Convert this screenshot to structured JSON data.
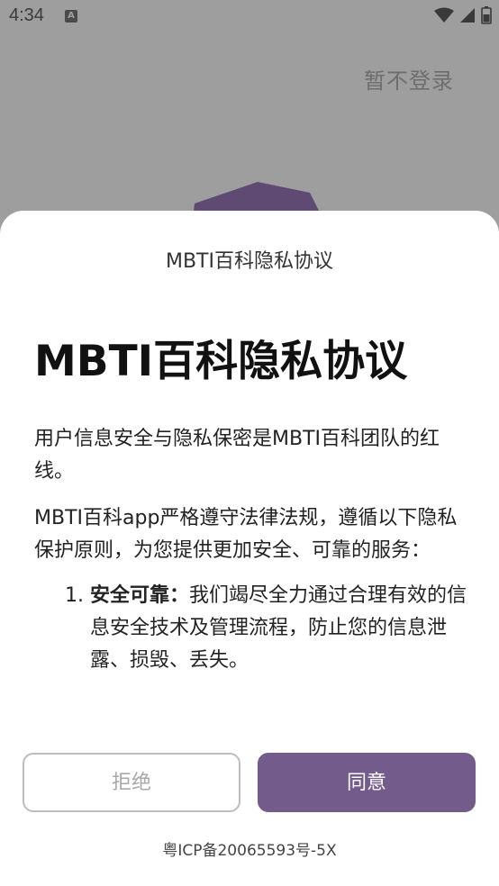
{
  "status_bar": {
    "time": "4:34",
    "notification_icon": "A"
  },
  "background": {
    "skip_login": "暂不登录"
  },
  "sheet": {
    "title": "MBTI百科隐私协议",
    "document_title": "MBTI百科隐私协议",
    "paragraph1": "用户信息安全与隐私保密是MBTI百科团队的红线。",
    "paragraph2": "MBTI百科app严格遵守法律法规，遵循以下隐私保护原则，为您提供更加安全、可靠的服务：",
    "principles": [
      {
        "number": "1.",
        "heading": "安全可靠：",
        "text": "我们竭尽全力通过合理有效的信息安全技术及管理流程，防止您的信息泄露、损毁、丢失。"
      }
    ],
    "reject_label": "拒绝",
    "agree_label": "同意",
    "icp": "粤ICP备20065593号-5X"
  },
  "colors": {
    "accent": "#735c8c",
    "overlay": "#9e9e9e"
  }
}
